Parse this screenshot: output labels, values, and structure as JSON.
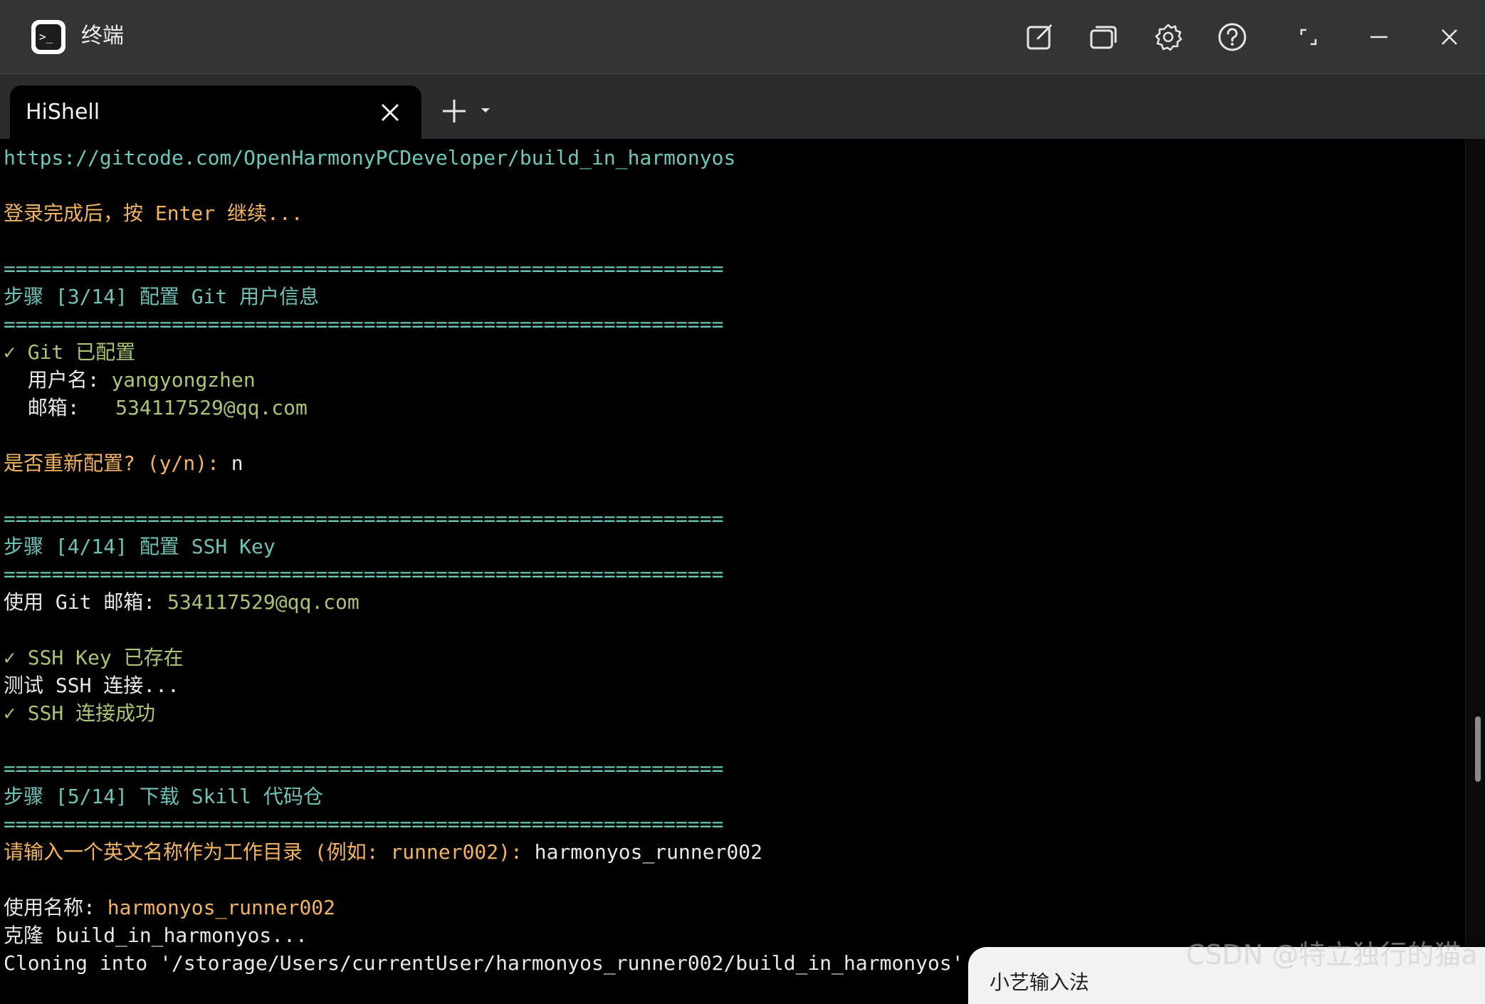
{
  "window": {
    "title": "终端",
    "app_icon_glyph": ">_",
    "icons": [
      "edit-icon",
      "window-copy-icon",
      "gear-icon",
      "help-icon",
      "restore-icon",
      "minimize-icon",
      "close-icon"
    ]
  },
  "tab": {
    "title": "HiShell"
  },
  "terminal": {
    "lines": [
      [
        {
          "t": "https://gitcode.com/OpenHarmonyPCDeveloper/build_in_harmonyos",
          "c": "link"
        }
      ],
      [],
      [
        {
          "t": "登录完成后，按 Enter 继续...",
          "c": "prompt"
        }
      ],
      [],
      [
        {
          "t": "============================================================",
          "c": "sep"
        }
      ],
      [
        {
          "t": "步骤 [3/14] 配置 Git 用户信息",
          "c": "step"
        }
      ],
      [
        {
          "t": "============================================================",
          "c": "sep"
        }
      ],
      [
        {
          "t": "✓ Git 已配置",
          "c": "ok"
        }
      ],
      [
        {
          "t": "  用户名: ",
          "c": "text"
        },
        {
          "t": "yangyongzhen",
          "c": "val"
        }
      ],
      [
        {
          "t": "  邮箱:   ",
          "c": "text"
        },
        {
          "t": "534117529@qq.com",
          "c": "val"
        }
      ],
      [],
      [
        {
          "t": "是否重新配置? (y/n): ",
          "c": "prompt"
        },
        {
          "t": "n",
          "c": "text"
        }
      ],
      [],
      [
        {
          "t": "============================================================",
          "c": "sep"
        }
      ],
      [
        {
          "t": "步骤 [4/14] 配置 SSH Key",
          "c": "step"
        }
      ],
      [
        {
          "t": "============================================================",
          "c": "sep"
        }
      ],
      [
        {
          "t": "使用 Git 邮箱: ",
          "c": "text"
        },
        {
          "t": "534117529@qq.com",
          "c": "val"
        }
      ],
      [],
      [
        {
          "t": "✓ SSH Key 已存在",
          "c": "ok"
        }
      ],
      [
        {
          "t": "测试 SSH 连接...",
          "c": "text"
        }
      ],
      [
        {
          "t": "✓ SSH 连接成功",
          "c": "ok"
        }
      ],
      [],
      [
        {
          "t": "============================================================",
          "c": "sep"
        }
      ],
      [
        {
          "t": "步骤 [5/14] 下载 Skill 代码仓",
          "c": "step"
        }
      ],
      [
        {
          "t": "============================================================",
          "c": "sep"
        }
      ],
      [
        {
          "t": "请输入一个英文名称作为工作目录 (例如: runner002): ",
          "c": "prompt"
        },
        {
          "t": "harmonyos_runner002",
          "c": "text"
        }
      ],
      [],
      [
        {
          "t": "使用名称: ",
          "c": "text"
        },
        {
          "t": "harmonyos_runner002",
          "c": "prompt"
        }
      ],
      [
        {
          "t": "克隆 build_in_harmonyos...",
          "c": "text"
        }
      ],
      [
        {
          "t": "Cloning into '/storage/Users/currentUser/harmonyos_runner002/build_in_harmonyos'...",
          "c": "text"
        }
      ]
    ]
  },
  "ime": {
    "label": "小艺输入法"
  },
  "watermark": {
    "text": "CSDN @特立独行的猫a"
  }
}
